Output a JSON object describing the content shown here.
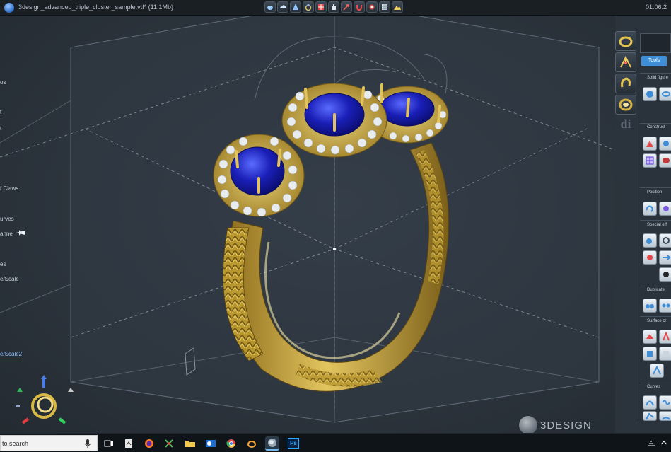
{
  "window": {
    "title": "3design_advanced_triple_cluster_sample.vtf* (11.1Mb)",
    "clock": "01:06:2"
  },
  "toolbar_icons": [
    "blob-icon",
    "cloud-icon",
    "cone-icon",
    "ring-icon",
    "grid-icon",
    "hand-icon",
    "arrow-icon",
    "magnet-icon",
    "eye-icon",
    "lattice-icon",
    "mountain-icon"
  ],
  "left_panel": {
    "items": [
      {
        "label": "os"
      },
      {
        "label": "t"
      },
      {
        "label": "t"
      },
      {
        "label": "f Claws"
      },
      {
        "label": "urves"
      },
      {
        "label": "annel"
      },
      {
        "label": "es"
      },
      {
        "label": "e/Scale"
      },
      {
        "label": "e/Scale2"
      }
    ]
  },
  "right_panel": {
    "tab_label": "Tools",
    "di_label": "di",
    "sections": [
      {
        "label": "Solid figure"
      },
      {
        "label": "Construct"
      },
      {
        "label": "Position"
      },
      {
        "label": "Special eff"
      },
      {
        "label": "Duplicate"
      },
      {
        "label": "Surface cr"
      },
      {
        "label": "Curves"
      }
    ]
  },
  "watermark": {
    "text": "3DESIGN"
  },
  "taskbar": {
    "search_placeholder": "to search",
    "apps": [
      "task-view",
      "file-app",
      "firefox",
      "media-app",
      "file-explorer",
      "outlook",
      "chrome",
      "ring-app",
      "3design",
      "photoshop"
    ],
    "active_app": "3design",
    "photoshop_label": "Ps"
  },
  "colors": {
    "gold": "#c9a93e",
    "gold_highlight": "#f4e08a",
    "gold_shadow": "#6e5618",
    "sapphire": "#1a1fb8",
    "diamond": "#e8ecef",
    "accent_blue": "#3f8fd8",
    "viewport_bg": "#2f3841"
  }
}
